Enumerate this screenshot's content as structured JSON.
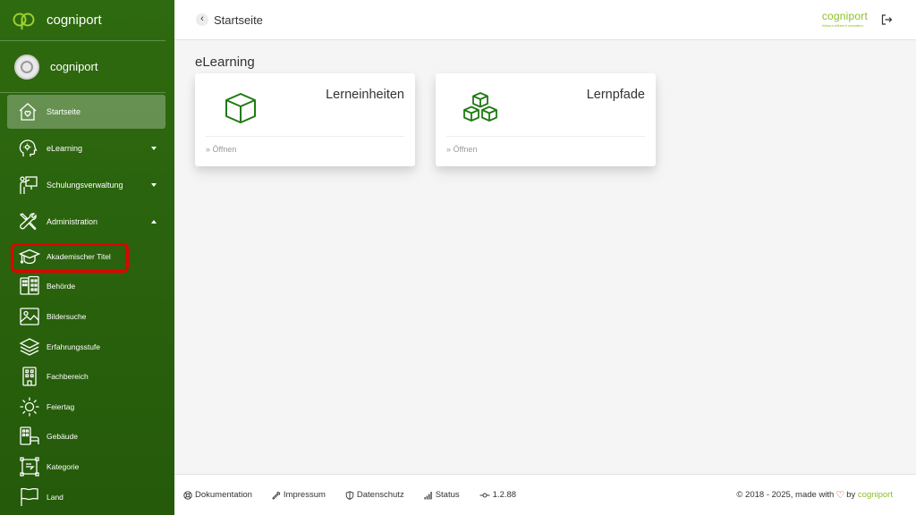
{
  "app": {
    "name": "cogniport"
  },
  "user": {
    "name": "cogniport"
  },
  "topbar": {
    "breadcrumb": "Startseite",
    "logo_word": "cogniport",
    "logo_tagline": "Wissen effizient verwalten"
  },
  "sidebar": {
    "main_items": [
      {
        "label": "Startseite",
        "icon": "home-heart-icon",
        "active": true
      },
      {
        "label": "eLearning",
        "icon": "head-gear-icon",
        "caret": "down"
      },
      {
        "label": "Schulungsverwaltung",
        "icon": "presenter-icon",
        "caret": "down"
      },
      {
        "label": "Administration",
        "icon": "tools-icon",
        "caret": "up"
      }
    ],
    "sub_items": [
      {
        "label": "Akademischer Titel",
        "icon": "graduation-cap-icon",
        "highlighted": true
      },
      {
        "label": "Behörde",
        "icon": "buildings-icon"
      },
      {
        "label": "Bildersuche",
        "icon": "image-icon"
      },
      {
        "label": "Erfahrungsstufe",
        "icon": "layers-icon"
      },
      {
        "label": "Fachbereich",
        "icon": "building-icon"
      },
      {
        "label": "Feiertag",
        "icon": "sun-icon"
      },
      {
        "label": "Gebäude",
        "icon": "building-bed-icon"
      },
      {
        "label": "Kategorie",
        "icon": "frame-icon"
      },
      {
        "label": "Land",
        "icon": "flag-icon"
      }
    ]
  },
  "main": {
    "section_title": "eLearning",
    "cards": [
      {
        "title": "Lerneinheiten",
        "link": "» Öffnen",
        "icon": "cube-icon"
      },
      {
        "title": "Lernpfade",
        "link": "» Öffnen",
        "icon": "cubes-icon"
      }
    ]
  },
  "footer": {
    "links": [
      {
        "label": "Dokumentation",
        "icon": "help-circle-icon"
      },
      {
        "label": "Impressum",
        "icon": "wrench-icon"
      },
      {
        "label": "Datenschutz",
        "icon": "shield-icon"
      },
      {
        "label": "Status",
        "icon": "signal-icon"
      },
      {
        "label": "1.2.88",
        "icon": "commit-icon"
      }
    ],
    "copyright_prefix": "© 2018 - 2025, made with",
    "copyright_by": "by",
    "copyright_brand": "cogniport"
  },
  "colors": {
    "sidebar": "#2a620d",
    "brand_green": "#8cbf26",
    "icon_green": "#1f7a12",
    "highlight_red": "#e30000"
  }
}
